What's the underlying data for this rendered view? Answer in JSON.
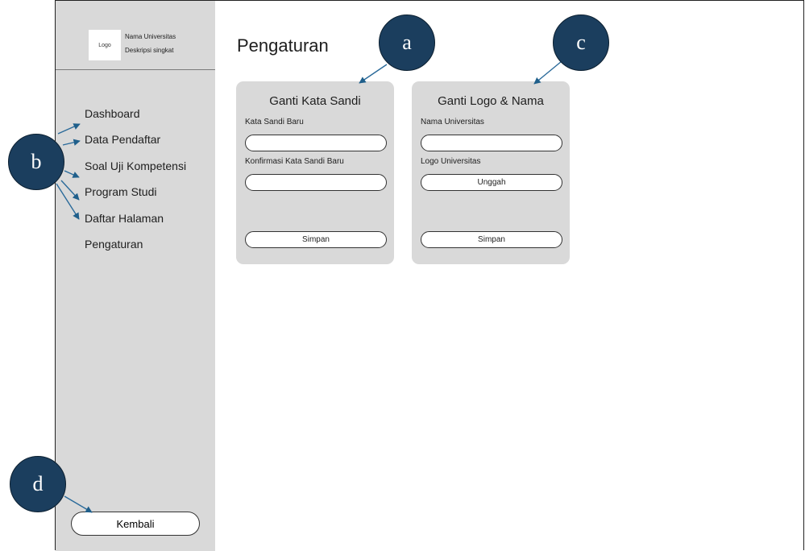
{
  "sidebar": {
    "logo_text": "Logo",
    "university_name": "Nama Universitas",
    "short_description": "Deskripsi singkat",
    "nav_items": [
      {
        "label": "Dashboard"
      },
      {
        "label": "Data Pendaftar"
      },
      {
        "label": "Soal Uji Kompetensi"
      },
      {
        "label": "Program Studi"
      },
      {
        "label": "Daftar Halaman"
      },
      {
        "label": "Pengaturan"
      }
    ],
    "back_label": "Kembali"
  },
  "main": {
    "page_title": "Pengaturan",
    "password_card": {
      "title": "Ganti Kata Sandi",
      "new_password_label": "Kata Sandi Baru",
      "new_password_value": "",
      "confirm_label": "Konfirmasi Kata Sandi Baru",
      "confirm_value": "",
      "save_label": "Simpan"
    },
    "logo_card": {
      "title": "Ganti Logo & Nama",
      "name_label": "Nama Universitas",
      "name_value": "",
      "logo_label": "Logo Universitas",
      "upload_label": "Unggah",
      "save_label": "Simpan"
    }
  },
  "callouts": {
    "a": "a",
    "b": "b",
    "c": "c",
    "d": "d"
  },
  "colors": {
    "sidebar_bg": "#d9d9d9",
    "card_bg": "#d9d9d9",
    "callout_fill": "#1b3e5e",
    "arrow": "#2a6a9a"
  }
}
